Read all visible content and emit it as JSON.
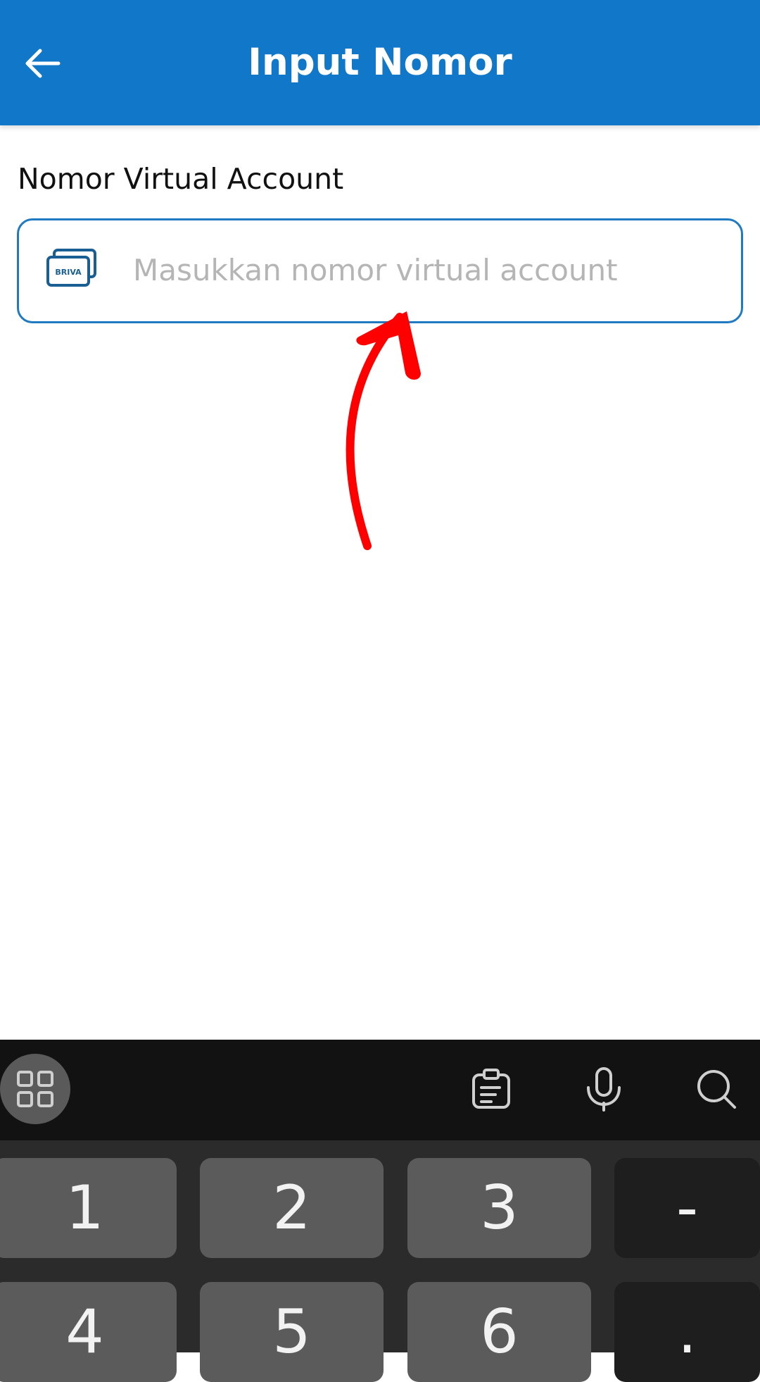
{
  "header": {
    "title": "Input Nomor",
    "background": "#1077c9"
  },
  "form": {
    "label": "Nomor Virtual Account",
    "input_placeholder": "Masukkan nomor virtual account",
    "input_value": "",
    "input_icon": "briva-card-icon",
    "input_icon_text": "BRIVA",
    "border_color": "#1f7ac2"
  },
  "annotation": {
    "icon": "red-arrow-icon",
    "color": "#ff0000"
  },
  "keyboard": {
    "toolbar": [
      "grid-icon",
      "clipboard-icon",
      "microphone-icon",
      "search-icon"
    ],
    "rows": [
      [
        "1",
        "2",
        "3",
        "-"
      ],
      [
        "4",
        "5",
        "6",
        "."
      ]
    ]
  }
}
